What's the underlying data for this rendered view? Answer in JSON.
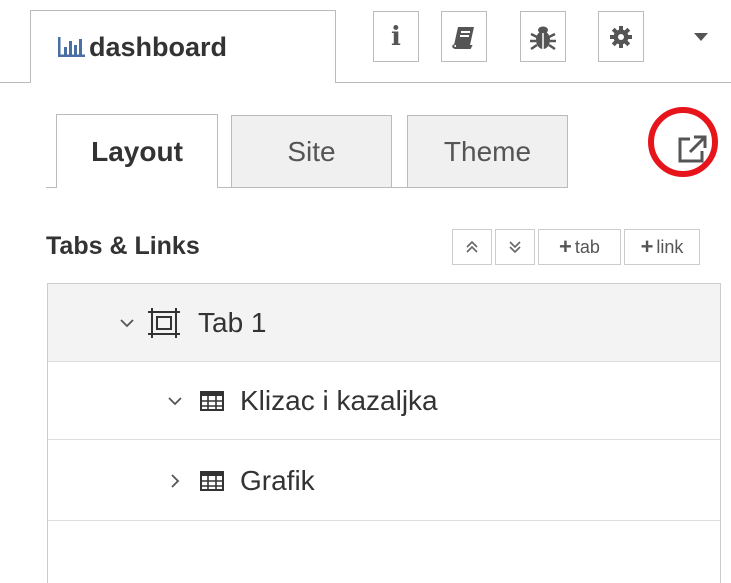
{
  "sidebar": {
    "dashboard_tab_label": "dashboard",
    "icon_buttons": [
      "info-icon",
      "book-icon",
      "bug-icon",
      "gear-icon"
    ],
    "menu": "chevron-down-icon"
  },
  "subtabs": [
    {
      "label": "Layout",
      "active": true
    },
    {
      "label": "Site",
      "active": false
    },
    {
      "label": "Theme",
      "active": false
    }
  ],
  "section": {
    "title": "Tabs & Links",
    "buttons": {
      "expand_label": "",
      "collapse_label": "",
      "add_tab_label": "tab",
      "add_link_label": "link"
    }
  },
  "tree": [
    {
      "label": "Tab 1",
      "type": "tab",
      "expanded": true
    },
    {
      "label": "Klizac i kazaljka",
      "type": "group",
      "expanded": true
    },
    {
      "label": "Grafik",
      "type": "group",
      "expanded": false
    }
  ],
  "colors": {
    "highlight_circle": "#e8141c",
    "border": "#bbbbbb",
    "tab_row_bg": "#f3f3f3"
  }
}
